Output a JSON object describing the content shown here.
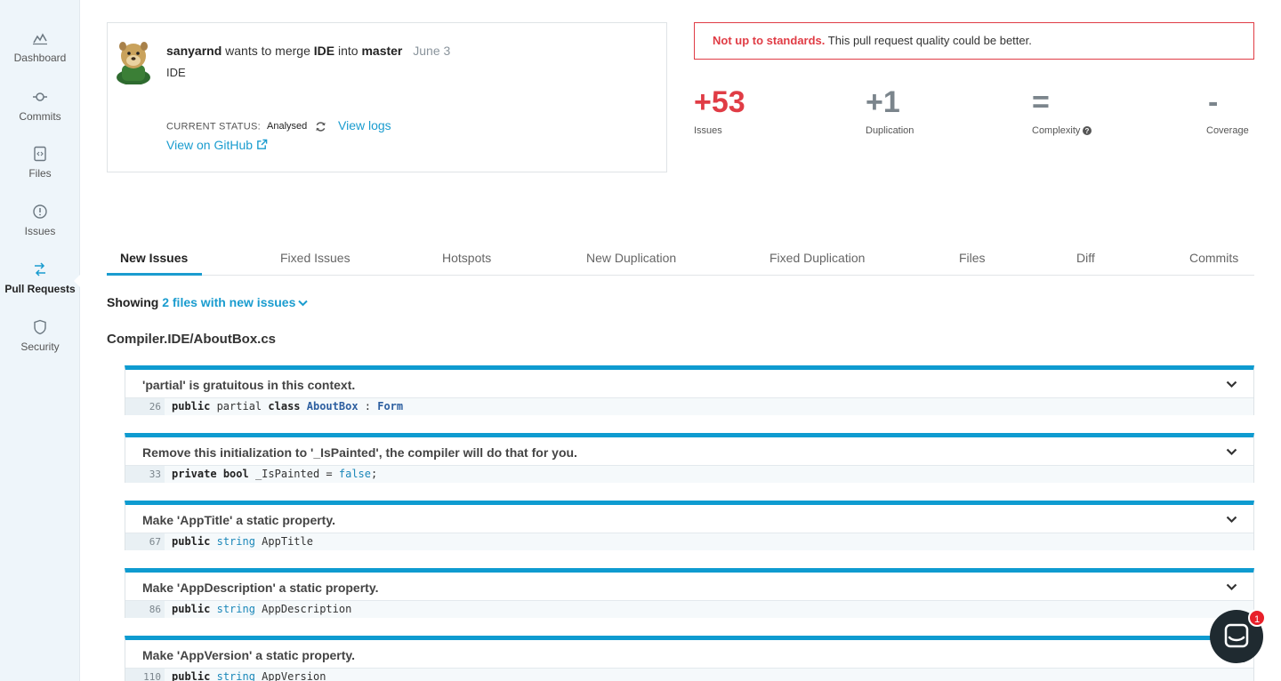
{
  "sidebar": {
    "items": [
      {
        "label": "Dashboard",
        "icon": "chart-icon"
      },
      {
        "label": "Commits",
        "icon": "commit-icon"
      },
      {
        "label": "Files",
        "icon": "file-code-icon"
      },
      {
        "label": "Issues",
        "icon": "alert-circle-icon"
      },
      {
        "label": "Pull Requests",
        "icon": "pull-request-icon",
        "active": true
      },
      {
        "label": "Security",
        "icon": "shield-icon"
      }
    ]
  },
  "pr": {
    "author": "sanyarnd",
    "wants": "wants to merge",
    "source": "IDE",
    "into": "into",
    "target": "master",
    "date": "June 3",
    "title": "IDE",
    "status_label": "CURRENT STATUS:",
    "status_value": "Analysed",
    "view_logs": "View logs",
    "view_github": "View on GitHub"
  },
  "alert": {
    "strong": "Not up to standards.",
    "text": "This pull request quality could be better."
  },
  "metrics": [
    {
      "value": "+53",
      "label": "Issues"
    },
    {
      "value": "+1",
      "label": "Duplication"
    },
    {
      "value": "=",
      "label": "Complexity"
    },
    {
      "value": "-",
      "label": "Coverage"
    }
  ],
  "tabs": [
    "New Issues",
    "Fixed Issues",
    "Hotspots",
    "New Duplication",
    "Fixed Duplication",
    "Files",
    "Diff",
    "Commits"
  ],
  "showing": {
    "label": "Showing",
    "link": "2 files with new issues"
  },
  "file_path": "Compiler.IDE/AboutBox.cs",
  "issues": [
    {
      "title": "'partial' is gratuitous in this context.",
      "line": "26"
    },
    {
      "title": "Remove this initialization to '_IsPainted', the compiler will do that for you.",
      "line": "33"
    },
    {
      "title": "Make 'AppTitle' a static property.",
      "line": "67"
    },
    {
      "title": "Make 'AppDescription' a static property.",
      "line": "86"
    },
    {
      "title": "Make 'AppVersion' a static property.",
      "line": "110"
    }
  ],
  "code": {
    "l26": {
      "kw1": "public",
      "t1": " partial ",
      "kw2": "class",
      "t2": " ",
      "cls": "AboutBox",
      "t3": " : ",
      "cls2": "Form"
    },
    "l33": {
      "kw1": "private",
      "t1": " ",
      "kw2": "bool",
      "t2": " _IsPainted = ",
      "type": "false",
      "t3": ";"
    },
    "l67": {
      "kw1": "public",
      "t1": " ",
      "type": "string",
      "t2": " AppTitle"
    },
    "l86": {
      "kw1": "public",
      "t1": " ",
      "type": "string",
      "t2": " AppDescription"
    },
    "l110": {
      "kw1": "public",
      "t1": " ",
      "type": "string",
      "t2": " AppVersion"
    }
  },
  "chat": {
    "badge": "1"
  },
  "colors": {
    "accent": "#1a9ccf",
    "danger": "#e03c45",
    "issue_border": "#0e9bd0",
    "sidebar_bg": "#eef5fa"
  }
}
